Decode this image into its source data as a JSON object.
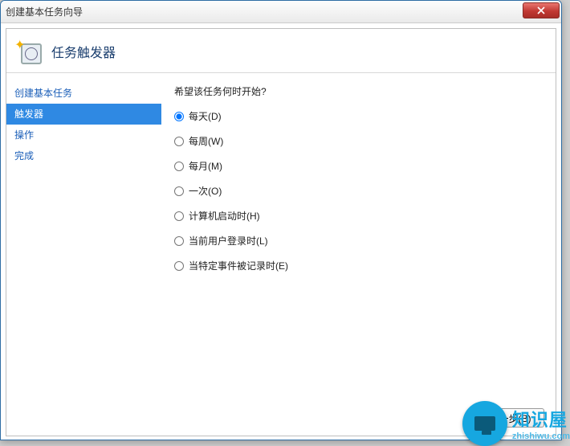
{
  "window": {
    "title": "创建基本任务向导"
  },
  "header": {
    "title": "任务触发器"
  },
  "sidebar": {
    "items": [
      {
        "label": "创建基本任务",
        "selected": false
      },
      {
        "label": "触发器",
        "selected": true
      },
      {
        "label": "操作",
        "selected": false
      },
      {
        "label": "完成",
        "selected": false
      }
    ]
  },
  "main": {
    "question": "希望该任务何时开始?",
    "options": [
      {
        "label": "每天(D)",
        "value": "daily",
        "selected": true
      },
      {
        "label": "每周(W)",
        "value": "weekly",
        "selected": false
      },
      {
        "label": "每月(M)",
        "value": "monthly",
        "selected": false
      },
      {
        "label": "一次(O)",
        "value": "once",
        "selected": false
      },
      {
        "label": "计算机启动时(H)",
        "value": "startup",
        "selected": false
      },
      {
        "label": "当前用户登录时(L)",
        "value": "logon",
        "selected": false
      },
      {
        "label": "当特定事件被记录时(E)",
        "value": "event",
        "selected": false
      }
    ]
  },
  "footer": {
    "back": "<上一步(B)"
  },
  "watermark": {
    "text": "知识屋",
    "url": "zhishiwu.com"
  }
}
